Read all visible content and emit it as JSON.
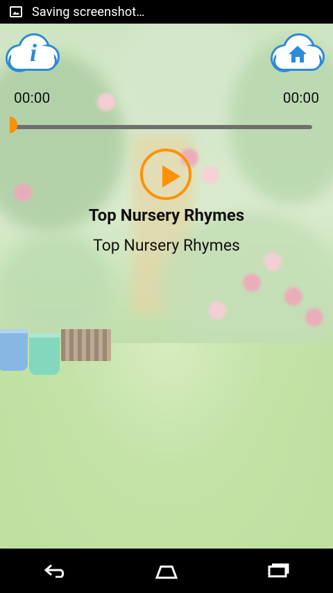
{
  "status_bar": {
    "text": "Saving screenshot…",
    "icon": "image-icon"
  },
  "player": {
    "current_time": "00:00",
    "total_time": "00:00",
    "progress": 0.0,
    "title": "Top Nursery Rhymes",
    "subtitle": "Top Nursery Rhymes"
  },
  "buttons": {
    "info": "info-icon",
    "home": "home-icon",
    "play": "play-icon"
  },
  "nav_bar": {
    "back": "back-icon",
    "home": "home-icon",
    "recents": "recent-apps-icon"
  },
  "colors": {
    "accent": "#ff9100",
    "cloud_outline": "#2b8bd6",
    "text": "#111111"
  }
}
